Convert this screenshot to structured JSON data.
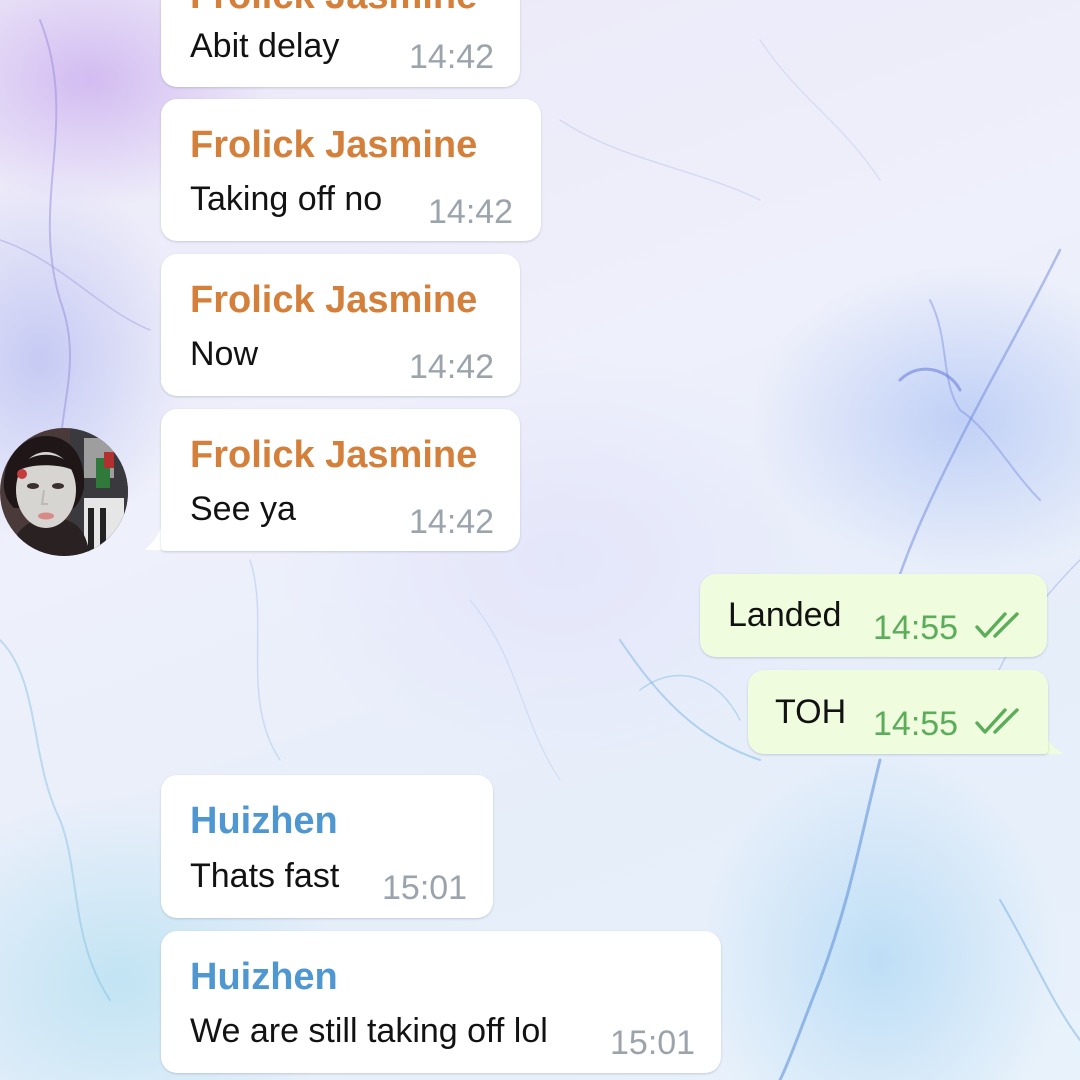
{
  "chat": {
    "messages": [
      {
        "direction": "in",
        "sender": "Frolick Jasmine",
        "text": "Abit delay",
        "time": "14:42"
      },
      {
        "direction": "in",
        "sender": "Frolick Jasmine",
        "text": "Taking off no",
        "time": "14:42"
      },
      {
        "direction": "in",
        "sender": "Frolick Jasmine",
        "text": "Now",
        "time": "14:42"
      },
      {
        "direction": "in",
        "sender": "Frolick Jasmine",
        "text": "See ya",
        "time": "14:42"
      },
      {
        "direction": "out",
        "text": "Landed",
        "time": "14:55",
        "status_icon": "double-check-icon"
      },
      {
        "direction": "out",
        "text": "TOH",
        "time": "14:55",
        "status_icon": "double-check-icon"
      },
      {
        "direction": "in",
        "sender": "Huizhen",
        "text": "Thats fast",
        "time": "15:01"
      },
      {
        "direction": "in",
        "sender": "Huizhen",
        "text": "We are still taking off lol",
        "time": "15:01"
      }
    ],
    "avatar": {
      "icon": "user-avatar-face-mask"
    }
  },
  "colors": {
    "incoming_bubble": "#ffffff",
    "outgoing_bubble": "#effdde",
    "sender_frolick": "#d47f3a",
    "sender_huizhen": "#4f97d1",
    "time_incoming": "#9ba4ad",
    "time_outgoing": "#5cad5a"
  }
}
